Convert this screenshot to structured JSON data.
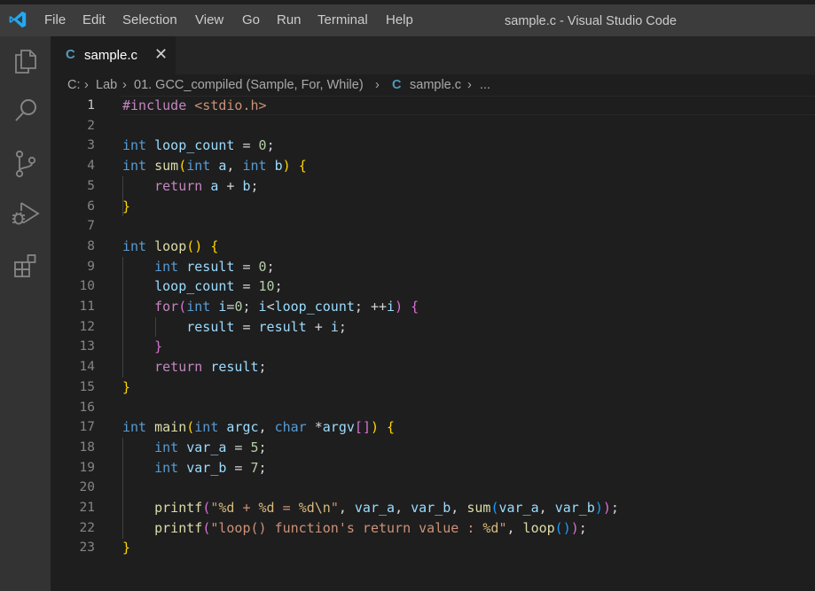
{
  "menu": [
    "File",
    "Edit",
    "Selection",
    "View",
    "Go",
    "Run",
    "Terminal",
    "Help"
  ],
  "window_title": "sample.c - Visual Studio Code",
  "tab": {
    "icon_letter": "C",
    "label": "sample.c",
    "close": "✕"
  },
  "breadcrumbs": {
    "drive": "C:",
    "sep": "›",
    "lab": "Lab",
    "folder": "01. GCC_compiled (Sample, For, While)",
    "file_icon": "C",
    "file": "sample.c",
    "more": "..."
  },
  "activity_icons": [
    "explorer-icon",
    "search-icon",
    "source-control-icon",
    "run-debug-icon",
    "extensions-icon"
  ],
  "editor": {
    "language": "c",
    "active_line": 1,
    "line_numbers": [
      "1",
      "2",
      "3",
      "4",
      "5",
      "6",
      "7",
      "8",
      "9",
      "10",
      "11",
      "12",
      "13",
      "14",
      "15",
      "16",
      "17",
      "18",
      "19",
      "20",
      "21",
      "22",
      "23"
    ],
    "lines": [
      "#include <stdio.h>",
      "",
      "int loop_count = 0;",
      "int sum(int a, int b) {",
      "    return a + b;",
      "}",
      "",
      "int loop() {",
      "    int result = 0;",
      "    loop_count = 10;",
      "    for(int i=0; i<loop_count; ++i) {",
      "        result = result + i;",
      "    }",
      "    return result;",
      "}",
      "",
      "int main(int argc, char *argv[]) {",
      "    int var_a = 5;",
      "    int var_b = 7;",
      "",
      "    printf(\"%d + %d = %d\\n\", var_a, var_b, sum(var_a, var_b));",
      "    printf(\"loop() function's return value : %d\", loop());",
      "}"
    ]
  },
  "colors": {
    "titlebar": "#3c3c3c",
    "activitybar": "#333333",
    "editor_bg": "#1e1e1e",
    "keyword": "#569cd6",
    "control": "#c586c0",
    "function": "#dcdcaa",
    "variable": "#9cdcfe",
    "number": "#b5cea8",
    "string": "#ce9178"
  }
}
